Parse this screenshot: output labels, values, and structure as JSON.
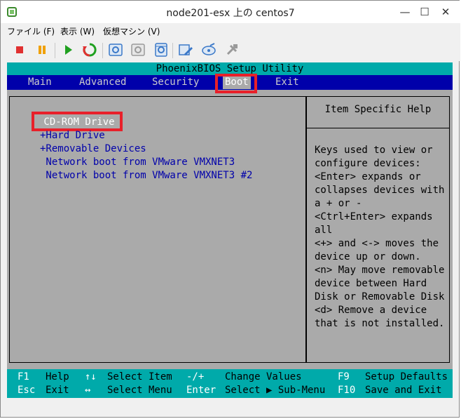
{
  "window": {
    "title": "node201-esx 上の centos7",
    "controls": {
      "minimize": "—",
      "maximize": "☐",
      "close": "✕"
    }
  },
  "menu": {
    "items": [
      "ファイル (F)",
      "表示 (W)",
      "仮想マシン (V)"
    ]
  },
  "toolbar": {
    "buttons": [
      {
        "name": "power-off-icon",
        "color": "#e03030"
      },
      {
        "name": "suspend-icon",
        "color": "#f0a000"
      },
      {
        "name": "power-on-icon",
        "color": "#20a020"
      },
      {
        "name": "reset-icon",
        "color": "#e03030"
      },
      {
        "name": "snapshot-take-icon",
        "color": "#3a78c8"
      },
      {
        "name": "snapshot-revert-icon",
        "color": "#9a9a9a"
      },
      {
        "name": "snapshot-manager-icon",
        "color": "#3a78c8"
      },
      {
        "name": "edit-settings-icon",
        "color": "#3a78c8"
      },
      {
        "name": "cd-connect-icon",
        "color": "#3a78c8"
      },
      {
        "name": "connect-devices-icon",
        "color": "#9a9a9a"
      }
    ]
  },
  "bios": {
    "title": "PhoenixBIOS Setup Utility",
    "tabs": [
      "Main",
      "Advanced",
      "Security",
      "Boot",
      "Exit"
    ],
    "active_tab": "Boot",
    "boot_items": [
      " CD-ROM Drive",
      "+Hard Drive",
      "+Removable Devices",
      " Network boot from VMware VMXNET3",
      " Network boot from VMware VMXNET3 #2"
    ],
    "help": {
      "title": "Item Specific Help",
      "lines": [
        "Keys used to view or",
        "configure devices:",
        "<Enter> expands or",
        "collapses devices with",
        "a + or -",
        "<Ctrl+Enter> expands",
        "all",
        "<+> and <-> moves the",
        "device up or down.",
        "<n> May move removable",
        "device between Hard",
        "Disk or Removable Disk",
        "<d> Remove a device",
        "that is not installed."
      ]
    },
    "footer": {
      "row1": [
        {
          "key": "F1",
          "desc": "Help"
        },
        {
          "key": "↑↓",
          "desc": "Select Item"
        },
        {
          "key": "-/+",
          "desc": "Change Values"
        },
        {
          "key": "F9",
          "desc": "Setup Defaults"
        }
      ],
      "row2": [
        {
          "key": "Esc",
          "desc": "Exit"
        },
        {
          "key": "↔",
          "desc": "Select Menu"
        },
        {
          "key": "Enter",
          "desc": "Select ▶ Sub-Menu"
        },
        {
          "key": "F10",
          "desc": "Save and Exit"
        }
      ]
    },
    "colors": {
      "background": "#aaaaaa",
      "tab_bar": "#0000aa",
      "title_bar": "#00aaaa",
      "item_text": "#0000aa",
      "highlight_box": "#e8202a"
    }
  }
}
